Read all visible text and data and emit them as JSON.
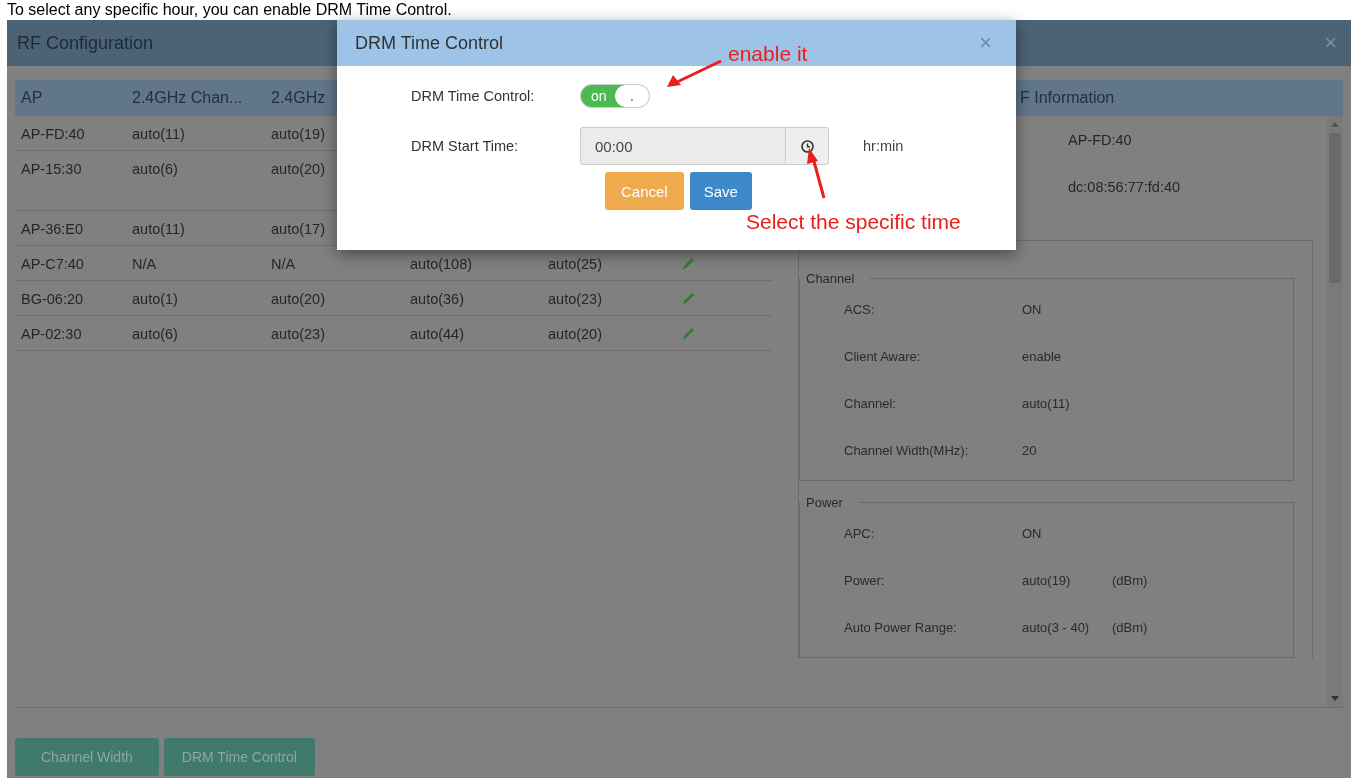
{
  "caption": "To select any specific hour, you can enable DRM Time Control.",
  "window": {
    "title": "RF Configuration",
    "close": "×"
  },
  "ap_table": {
    "columns": [
      "AP",
      "2.4GHz Chan...",
      "2.4GHz"
    ],
    "rows": [
      {
        "cells": [
          "AP-FD:40",
          "auto(11)",
          "auto(19)"
        ],
        "tall": false
      },
      {
        "cells": [
          "AP-15:30",
          "auto(6)",
          "auto(20)"
        ],
        "tall": true
      },
      {
        "cells": [
          "AP-36:E0",
          "auto(11)",
          "auto(17)"
        ],
        "tall": false
      },
      {
        "cells": [
          "AP-C7:40",
          "N/A",
          "N/A",
          "auto(108)",
          "auto(25)"
        ],
        "tall": false
      },
      {
        "cells": [
          "BG-06:20",
          "auto(1)",
          "auto(20)",
          "auto(36)",
          "auto(23)"
        ],
        "tall": false
      },
      {
        "cells": [
          "AP-02:30",
          "auto(6)",
          "auto(23)",
          "auto(44)",
          "auto(20)"
        ],
        "tall": false
      }
    ]
  },
  "rf_info": {
    "title": "F Information",
    "summary": [
      "AP-FD:40",
      "dc:08:56:77:fd:40"
    ],
    "groups": [
      {
        "legend": "Channel",
        "items": [
          {
            "label": "ACS:",
            "value": "ON"
          },
          {
            "label": "Client Aware:",
            "value": "enable"
          },
          {
            "label": "Channel:",
            "value": "auto(11)"
          },
          {
            "label": "Channel Width(MHz):",
            "value": "20"
          }
        ]
      },
      {
        "legend": "Power",
        "items": [
          {
            "label": "APC:",
            "value": "ON"
          },
          {
            "label": "Power:",
            "value": "auto(19)",
            "unit": "(dBm)"
          },
          {
            "label": "Auto Power Range:",
            "value": "auto(3 - 40)",
            "unit": "(dBm)"
          }
        ]
      }
    ]
  },
  "footer_buttons": [
    "Channel Width",
    "DRM Time Control"
  ],
  "dialog": {
    "title": "DRM Time Control",
    "close": "×",
    "fields": [
      {
        "kind": "toggle",
        "label": "DRM Time Control:",
        "on": true,
        "on_text": "on",
        "knob_text": "."
      },
      {
        "kind": "time",
        "label": "DRM Start Time:",
        "value": "00:00",
        "unit": "hr:min"
      }
    ],
    "buttons": [
      {
        "kind": "cancel",
        "label": "Cancel"
      },
      {
        "kind": "save",
        "label": "Save"
      }
    ]
  },
  "annotations": [
    {
      "kind": "toggle",
      "text": "enable it"
    },
    {
      "kind": "time",
      "text": "Select the specific time"
    }
  ]
}
